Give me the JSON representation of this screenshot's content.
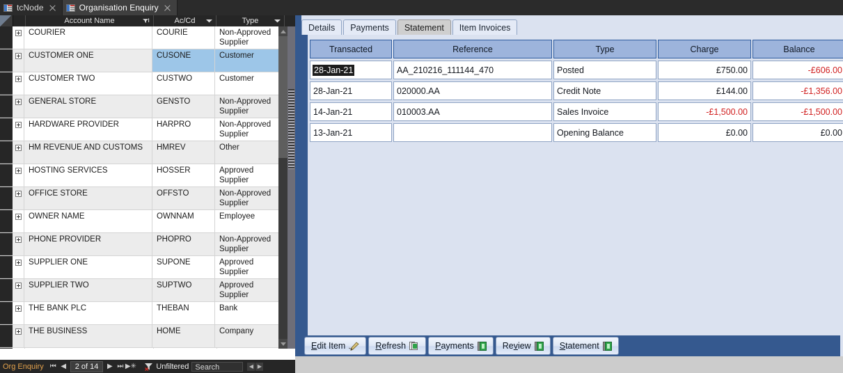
{
  "window": {
    "tabs": [
      {
        "label": "tcNode",
        "active": false,
        "icon": "form-icon",
        "closable": true
      },
      {
        "label": "Organisation Enquiry",
        "active": true,
        "icon": "form-icon",
        "closable": true
      }
    ]
  },
  "datasheet": {
    "columns": [
      {
        "label": "Account Name",
        "indicator": "filter-sort-icon"
      },
      {
        "label": "Ac/Cd",
        "indicator": "chevron-down-icon"
      },
      {
        "label": "Type",
        "indicator": "chevron-down-icon"
      }
    ],
    "rows": [
      {
        "name": "COURIER",
        "code": "COURIE",
        "type": "Non-Approved Supplier",
        "selected": false
      },
      {
        "name": "CUSTOMER ONE",
        "code": "CUSONE",
        "type": "Customer",
        "selected": true
      },
      {
        "name": "CUSTOMER TWO",
        "code": "CUSTWO",
        "type": "Customer",
        "selected": false
      },
      {
        "name": "GENERAL STORE",
        "code": "GENSTO",
        "type": "Non-Approved Supplier",
        "selected": false
      },
      {
        "name": "HARDWARE PROVIDER",
        "code": "HARPRO",
        "type": "Non-Approved Supplier",
        "selected": false
      },
      {
        "name": "HM REVENUE AND CUSTOMS",
        "code": "HMREV",
        "type": "Other",
        "selected": false
      },
      {
        "name": "HOSTING SERVICES",
        "code": "HOSSER",
        "type": "Approved Supplier",
        "selected": false
      },
      {
        "name": "OFFICE STORE",
        "code": "OFFSTO",
        "type": "Non-Approved Supplier",
        "selected": false
      },
      {
        "name": "OWNER NAME",
        "code": "OWNNAM",
        "type": "Employee",
        "selected": false
      },
      {
        "name": "PHONE PROVIDER",
        "code": "PHOPRO",
        "type": "Non-Approved Supplier",
        "selected": false
      },
      {
        "name": "SUPPLIER ONE",
        "code": "SUPONE",
        "type": "Approved Supplier",
        "selected": false
      },
      {
        "name": "SUPPLIER TWO",
        "code": "SUPTWO",
        "type": "Approved Supplier",
        "selected": false
      },
      {
        "name": "THE BANK PLC",
        "code": "THEBAN",
        "type": "Bank",
        "selected": false
      },
      {
        "name": "THE BUSINESS",
        "code": "HOME",
        "type": "Company",
        "selected": false
      }
    ],
    "new_row_marker": "✳"
  },
  "statusbar": {
    "title": "Org Enquiry",
    "first_label": "⏮",
    "prev_label": "◀",
    "record": "2 of 14",
    "next_label": "▶",
    "last_label": "⏭",
    "newrec_label": "▶✳",
    "filter_label": "Unfiltered",
    "filter_icon": "funnel-clear-icon",
    "search_placeholder": "Search",
    "search_value": "",
    "hscroll_left": "◀",
    "hscroll_right": "▶"
  },
  "form": {
    "tabs": [
      {
        "label": "Details",
        "active": false
      },
      {
        "label": "Payments",
        "active": false
      },
      {
        "label": "Statement",
        "active": true
      },
      {
        "label": "Item Invoices",
        "active": false
      }
    ],
    "grid": {
      "columns": [
        "Transacted",
        "Reference",
        "Type",
        "Charge",
        "Balance"
      ],
      "rows": [
        {
          "transacted": "28-Jan-21",
          "reference": "AA_210216_111144_470",
          "type": "Posted",
          "charge": "£750.00",
          "charge_negative": false,
          "balance": "-£606.00",
          "balance_negative": true,
          "date_selected": true
        },
        {
          "transacted": "28-Jan-21",
          "reference": "020000.AA",
          "type": "Credit Note",
          "charge": "£144.00",
          "charge_negative": false,
          "balance": "-£1,356.00",
          "balance_negative": true,
          "date_selected": false
        },
        {
          "transacted": "14-Jan-21",
          "reference": "010003.AA",
          "type": "Sales Invoice",
          "charge": "-£1,500.00",
          "charge_negative": true,
          "balance": "-£1,500.00",
          "balance_negative": true,
          "date_selected": false
        },
        {
          "transacted": "13-Jan-21",
          "reference": "",
          "type": "Opening Balance",
          "charge": "£0.00",
          "charge_negative": false,
          "balance": "£0.00",
          "balance_negative": false,
          "date_selected": false
        }
      ]
    },
    "buttons": [
      {
        "accel": "E",
        "rest": "dit Item",
        "icon": "pencil-icon"
      },
      {
        "accel": "R",
        "rest": "efresh",
        "icon": "refresh-page-icon"
      },
      {
        "accel": "P",
        "rest": "ayments",
        "icon": "ledger-book-icon"
      },
      {
        "pre": "Re",
        "accel": "v",
        "rest": "iew",
        "icon": "ledger-book-icon"
      },
      {
        "accel": "S",
        "rest": "tatement",
        "icon": "ledger-book-icon"
      }
    ]
  },
  "colors": {
    "accent_blue": "#35598f",
    "header_blue": "#9db4dc",
    "selection_blue": "#9dc6e8",
    "negative_red": "#d01f1f",
    "status_orange": "#e2a14c"
  }
}
